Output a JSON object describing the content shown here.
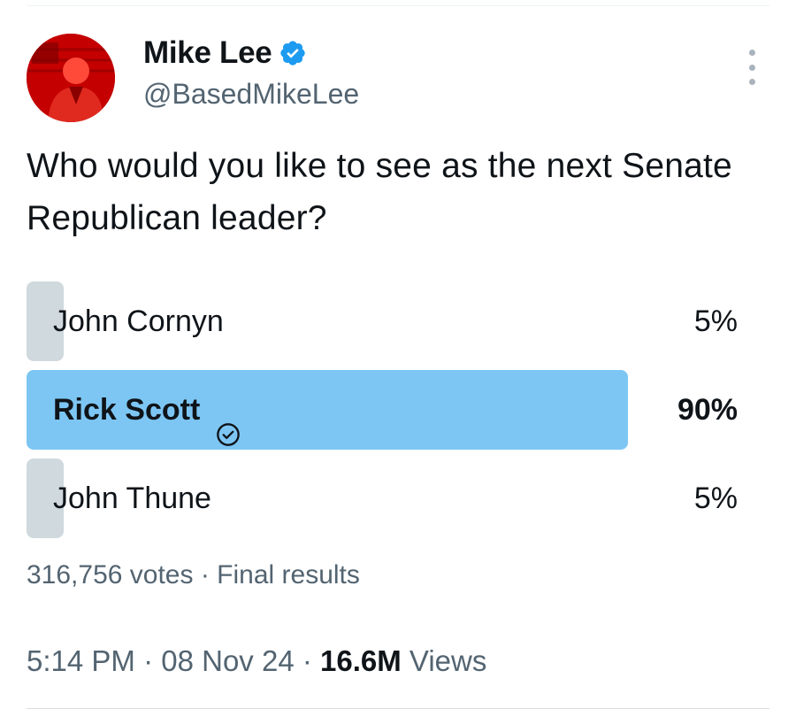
{
  "author": {
    "name": "Mike Lee",
    "handle": "@BasedMikeLee",
    "verified": true
  },
  "tweet": {
    "text": "Who would you like to see as the next Senate Republican leader?"
  },
  "poll": {
    "options": [
      {
        "label": "John Cornyn",
        "percent": "5%",
        "value": 5,
        "winner": false
      },
      {
        "label": "Rick Scott",
        "percent": "90%",
        "value": 90,
        "winner": true
      },
      {
        "label": "John Thune",
        "percent": "5%",
        "value": 5,
        "winner": false
      }
    ],
    "votes": "316,756 votes",
    "status": "Final results",
    "separator": "·"
  },
  "meta": {
    "time": "5:14 PM",
    "date": "08 Nov 24",
    "views_count": "16.6M",
    "views_label": "Views",
    "separator": "·"
  },
  "colors": {
    "winner_bar": "#7dc6f4",
    "loser_bar": "#cfd9de",
    "verified_badge": "#1d9bf0",
    "secondary_text": "#536471"
  },
  "icons": {
    "verified": "verified-badge-icon",
    "winner_check": "check-circle-icon",
    "more": "more-vertical-icon"
  }
}
